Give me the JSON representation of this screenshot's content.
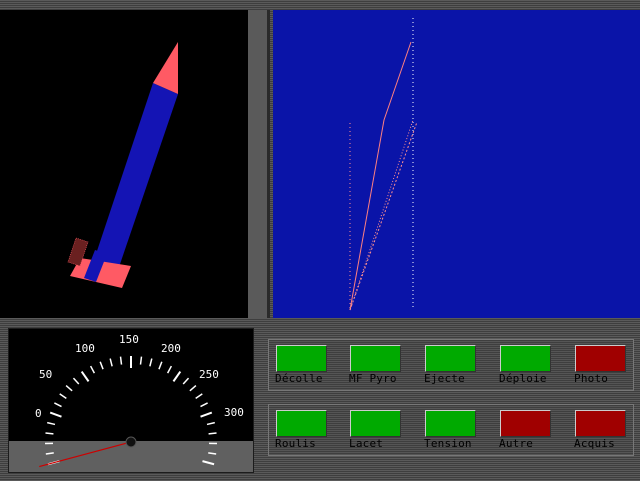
{
  "colors": {
    "rocket_body": "#1414b4",
    "rocket_accent": "#ff5a64",
    "trajectory_bg": "#0a14a8",
    "lamp_on": "#00aa00",
    "lamp_off": "#a00000",
    "needle": "#cc0000"
  },
  "speedometer": {
    "scale_min": 0,
    "scale_max": 300,
    "scale_labels": [
      "0",
      "50",
      "100",
      "150",
      "200",
      "250",
      "300"
    ],
    "value": 0
  },
  "indicators": {
    "row1": [
      {
        "label": "Décolle",
        "state": "on"
      },
      {
        "label": "MF Pyro",
        "state": "on"
      },
      {
        "label": "Ejecte",
        "state": "on"
      },
      {
        "label": "Déploie",
        "state": "on"
      },
      {
        "label": "Photo",
        "state": "off"
      }
    ],
    "row2": [
      {
        "label": "Roulis",
        "state": "on"
      },
      {
        "label": "Lacet",
        "state": "on"
      },
      {
        "label": "Tension",
        "state": "on"
      },
      {
        "label": "Autre",
        "state": "off"
      },
      {
        "label": "Acquis",
        "state": "off"
      }
    ]
  }
}
